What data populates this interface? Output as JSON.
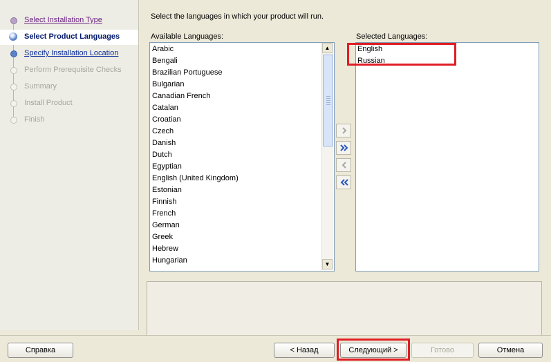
{
  "nav": {
    "steps": [
      {
        "label": "Select Installation Type",
        "state": "done"
      },
      {
        "label": "Select Product Languages",
        "state": "active"
      },
      {
        "label": "Specify Installation Location",
        "state": "link"
      },
      {
        "label": "Perform Prerequisite Checks",
        "state": "todo"
      },
      {
        "label": "Summary",
        "state": "todo"
      },
      {
        "label": "Install Product",
        "state": "todo"
      },
      {
        "label": "Finish",
        "state": "todo"
      }
    ]
  },
  "main": {
    "instruction": "Select the languages in which your product will run.",
    "available": {
      "label": "Available Languages:",
      "items": [
        "Arabic",
        "Bengali",
        "Brazilian Portuguese",
        "Bulgarian",
        "Canadian French",
        "Catalan",
        "Croatian",
        "Czech",
        "Danish",
        "Dutch",
        "Egyptian",
        "English (United Kingdom)",
        "Estonian",
        "Finnish",
        "French",
        "German",
        "Greek",
        "Hebrew",
        "Hungarian"
      ]
    },
    "selected": {
      "label": "Selected Languages:",
      "items": [
        "English",
        "Russian"
      ]
    },
    "move_buttons": [
      "move-right-icon",
      "move-all-right-icon",
      "move-left-icon",
      "move-all-left-icon"
    ]
  },
  "footer": {
    "help": "Справка",
    "back": "< Назад",
    "next": "Следующий >",
    "finish": "Готово",
    "cancel": "Отмена"
  },
  "colors": {
    "highlight": "#e01c24",
    "accent": "#2a55c0"
  }
}
